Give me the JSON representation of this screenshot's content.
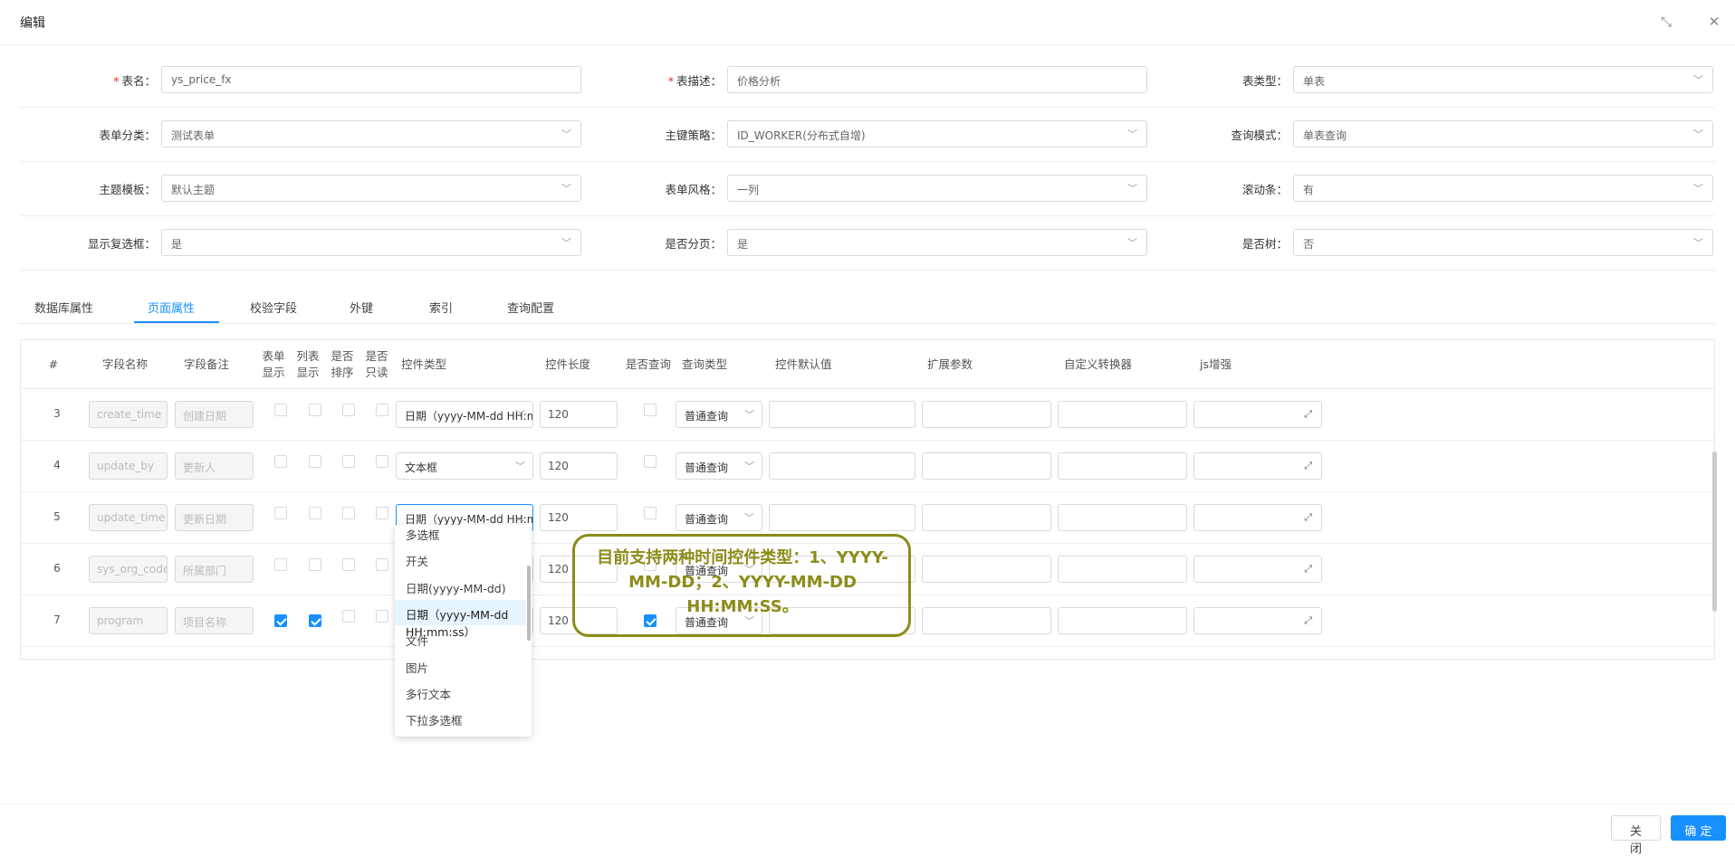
{
  "modal": {
    "title": "编辑"
  },
  "form": {
    "rows": [
      [
        {
          "label": "表名",
          "required": true,
          "value": "ys_price_fx",
          "select": false
        },
        {
          "label": "表描述",
          "required": true,
          "value": "价格分析",
          "select": false
        },
        {
          "label": "表类型",
          "required": false,
          "value": "单表",
          "select": true
        }
      ],
      [
        {
          "label": "表单分类",
          "required": false,
          "value": "测试表单",
          "select": true
        },
        {
          "label": "主键策略",
          "required": false,
          "value": "ID_WORKER(分布式自增)",
          "select": true
        },
        {
          "label": "查询模式",
          "required": false,
          "value": "单表查询",
          "select": true
        }
      ],
      [
        {
          "label": "主题模板",
          "required": false,
          "value": "默认主题",
          "select": true
        },
        {
          "label": "表单风格",
          "required": false,
          "value": "一列",
          "select": true
        },
        {
          "label": "滚动条",
          "required": false,
          "value": "有",
          "select": true
        }
      ],
      [
        {
          "label": "显示复选框",
          "required": false,
          "value": "是",
          "select": true
        },
        {
          "label": "是否分页",
          "required": false,
          "value": "是",
          "select": true
        },
        {
          "label": "是否树",
          "required": false,
          "value": "否",
          "select": true
        }
      ]
    ]
  },
  "tabs": [
    "数据库属性",
    "页面属性",
    "校验字段",
    "外键",
    "索引",
    "查询配置"
  ],
  "active_tab": "页面属性",
  "table": {
    "headers": {
      "num": "#",
      "name": "字段名称",
      "remark": "字段备注",
      "form_show_1": "表单",
      "form_show_2": "显示",
      "list_show_1": "列表",
      "list_show_2": "显示",
      "sort_1": "是否",
      "sort_2": "排序",
      "readonly_1": "是否",
      "readonly_2": "只读",
      "ctrl_type": "控件类型",
      "ctrl_len": "控件长度",
      "is_query": "是否查询",
      "query_type": "查询类型",
      "default_val": "控件默认值",
      "ext_param": "扩展参数",
      "converter": "自定义转换器",
      "js": "js增强"
    },
    "rows": [
      {
        "num": "3",
        "name": "create_time",
        "remark": "创建日期",
        "form": false,
        "list": false,
        "sort": false,
        "ro": false,
        "ctrl": "日期（yyyy-MM-dd HH:mm:ss）",
        "len": "120",
        "query": false,
        "qtype": "普通查询"
      },
      {
        "num": "4",
        "name": "update_by",
        "remark": "更新人",
        "form": false,
        "list": false,
        "sort": false,
        "ro": false,
        "ctrl": "文本框",
        "len": "120",
        "query": false,
        "qtype": "普通查询"
      },
      {
        "num": "5",
        "name": "update_time",
        "remark": "更新日期",
        "form": false,
        "list": false,
        "sort": false,
        "ro": false,
        "ctrl": "日期（yyyy-MM-dd HH:mm:ss）",
        "len": "120",
        "query": false,
        "qtype": "普通查询"
      },
      {
        "num": "6",
        "name": "sys_org_code",
        "remark": "所属部门",
        "form": false,
        "list": false,
        "sort": false,
        "ro": false,
        "ctrl": "",
        "len": "120",
        "query": false,
        "qtype": "普通查询"
      },
      {
        "num": "7",
        "name": "program",
        "remark": "项目名称",
        "form": true,
        "list": true,
        "sort": false,
        "ro": false,
        "ctrl": "",
        "len": "120",
        "query": true,
        "qtype": "普通查询"
      }
    ]
  },
  "dropdown": {
    "items": [
      "多选框",
      "开关",
      "日期(yyyy-MM-dd)",
      "日期（yyyy-MM-dd HH:mm:ss）",
      "文件",
      "图片",
      "多行文本",
      "下拉多选框"
    ],
    "selected_index": 3
  },
  "callout": {
    "text": "目前支持两种时间控件类型：1、YYYY-MM-DD；2、YYYY-MM-DD HH:MM:SS。"
  },
  "footer": {
    "close": "关 闭",
    "ok": "确 定"
  },
  "colors": {
    "accent": "#1890ff",
    "callout": "#8c8c1a"
  },
  "icons": {
    "maximize": "maximize-icon",
    "close": "close-icon",
    "chevron": "chevron-down-icon",
    "expand": "expand-icon"
  }
}
